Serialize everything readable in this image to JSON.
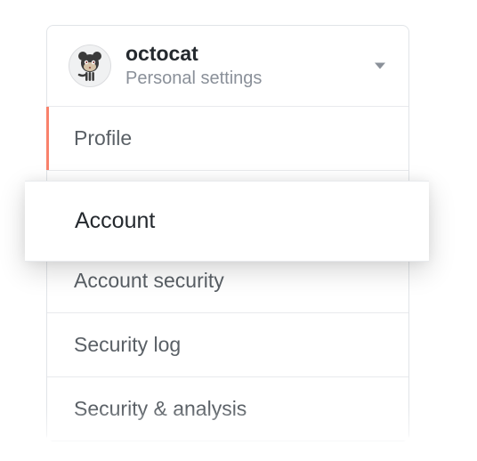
{
  "header": {
    "username": "octocat",
    "subtitle": "Personal settings"
  },
  "menu": {
    "profile": "Profile",
    "account": "Account",
    "account_security": "Account security",
    "security_log": "Security log",
    "security_analysis": "Security & analysis"
  },
  "icons": {
    "avatar": "octocat-avatar",
    "dropdown": "caret-down-icon"
  }
}
